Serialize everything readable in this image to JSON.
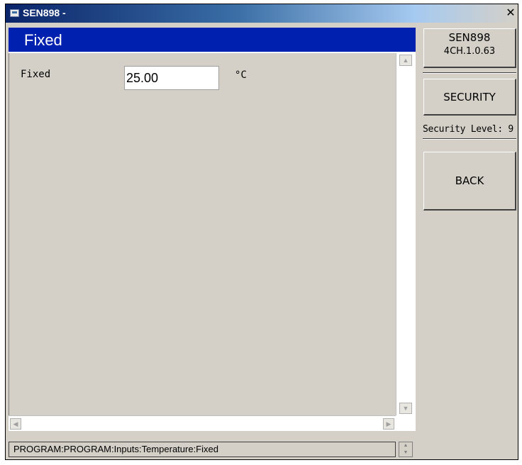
{
  "window": {
    "title": "SEN898 -",
    "close_glyph": "✕"
  },
  "header": {
    "title": "Fixed"
  },
  "form": {
    "label": "Fixed",
    "value": "25.00",
    "unit": "°C"
  },
  "sidebar": {
    "version_line1": "SEN898",
    "version_line2": "4CH.1.0.63",
    "security_label": "SECURITY",
    "security_level": "Security Level: 9",
    "back_label": "BACK"
  },
  "status": {
    "path": "PROGRAM:PROGRAM:Inputs:Temperature:Fixed"
  },
  "icons": {
    "app": "app-window-icon",
    "close": "close-icon",
    "scroll_up": "arrow-up-icon",
    "scroll_down": "arrow-down-icon",
    "scroll_left": "arrow-left-icon",
    "scroll_right": "arrow-right-icon"
  },
  "colors": {
    "header_bg": "#0020b0",
    "titlebar_start": "#0a246a",
    "window_bg": "#d4d0c8"
  }
}
